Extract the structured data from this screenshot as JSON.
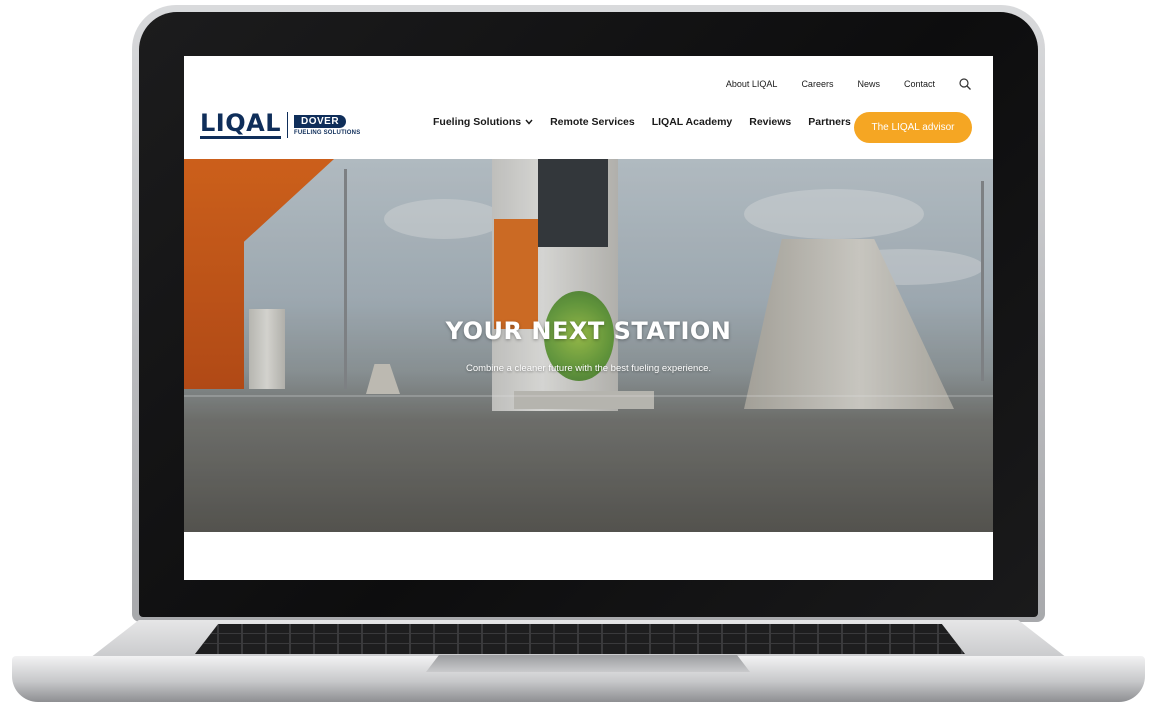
{
  "topnav": {
    "about": "About LIQAL",
    "careers": "Careers",
    "news": "News",
    "contact": "Contact"
  },
  "logo": {
    "liqal": "LIQAL",
    "dover": "DOVER",
    "dover_sub": "FUELING SOLUTIONS"
  },
  "mainnav": {
    "fueling": "Fueling Solutions",
    "remote": "Remote Services",
    "academy": "LIQAL Academy",
    "reviews": "Reviews",
    "partners": "Partners"
  },
  "cta": {
    "label": "The LIQAL advisor"
  },
  "hero": {
    "title": "YOUR NEXT STATION",
    "subtitle": "Combine a cleaner future with the best fueling experience."
  },
  "colors": {
    "brand_navy": "#0f2e5a",
    "accent_orange": "#f5a623"
  },
  "icons": {
    "search": "search-icon",
    "chevron": "chevron-down-icon"
  }
}
